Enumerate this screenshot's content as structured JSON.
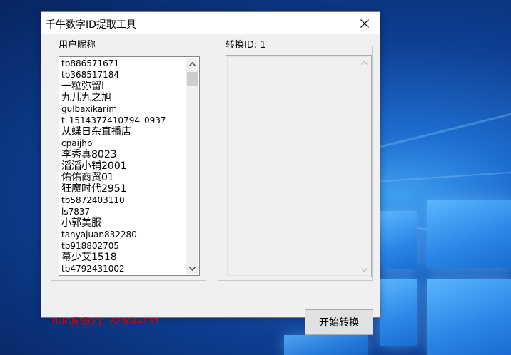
{
  "window": {
    "title": "千牛数字ID提取工具",
    "close_icon": "close-icon"
  },
  "nickname_group": {
    "label": "用户昵称",
    "items": [
      "tb886571671",
      "tb368517184",
      "一粒弥留I",
      "九儿九之旭",
      "gulbaxikarim",
      "t_1514377410794_0937",
      "从蝶日杂直播店",
      "cpaijhp",
      "李秀真8023",
      "滔滔小铺2001",
      "佑佑商贸01",
      "狂魔时代2951",
      "tb5872403110",
      "ls7837",
      "小郭美服",
      "tanyajuan832280",
      "tb918802705",
      "幕少艾1518",
      "tb4792431002"
    ]
  },
  "convert_group": {
    "label": "转换ID: 1"
  },
  "footer": {
    "bug_feedback": "BUG反馈QQ：623044137",
    "convert_button": "开始转换"
  },
  "colors": {
    "bug_text": "#e00000",
    "window_bg": "#f0f0f0"
  }
}
